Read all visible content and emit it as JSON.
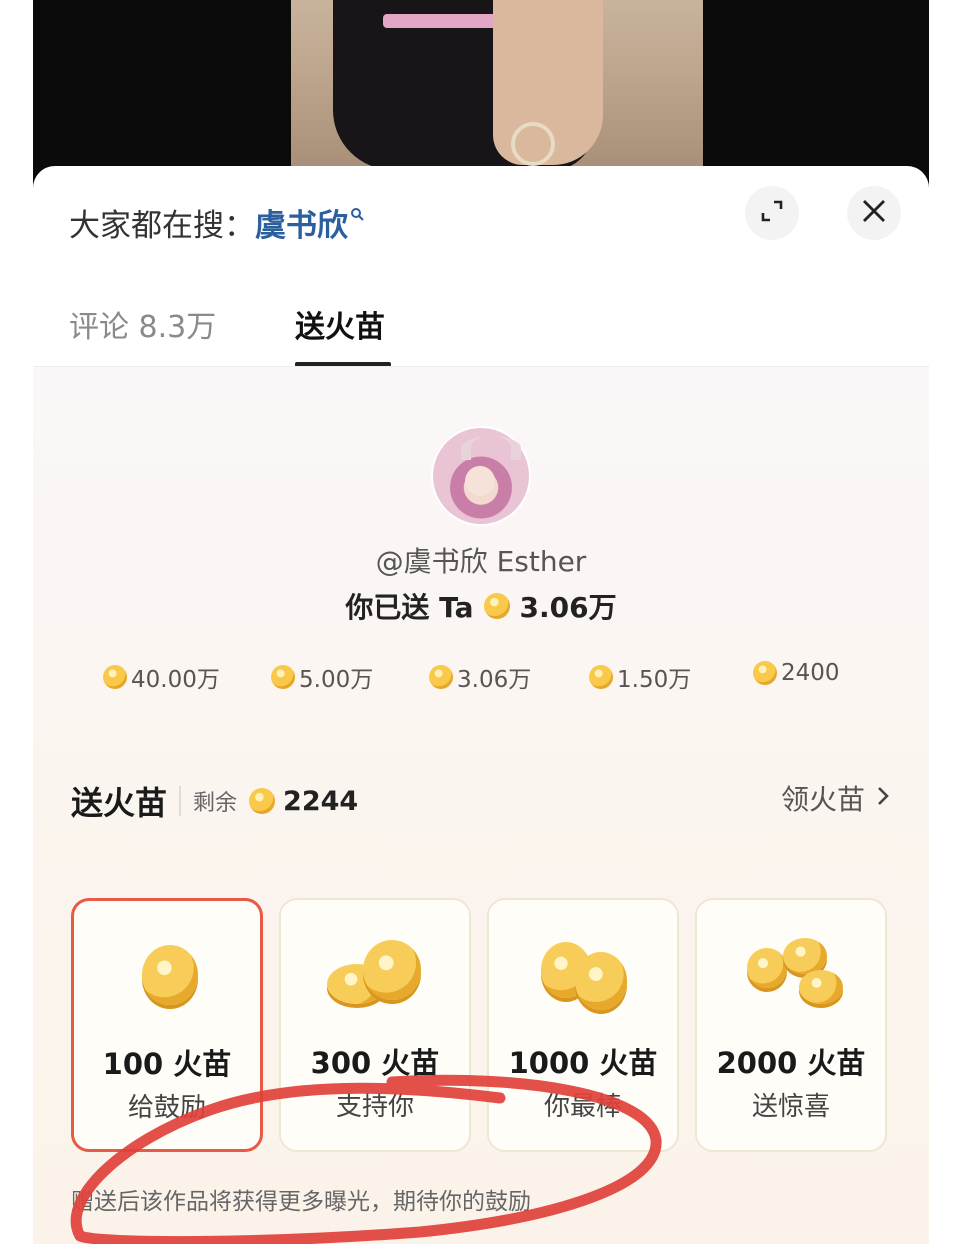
{
  "search_bar": {
    "prefix": "大家都在搜：",
    "term": "虞书欣"
  },
  "tabs": [
    {
      "label": "评论 8.3万"
    },
    {
      "label": "送火苗"
    }
  ],
  "creator": {
    "handle": "@虞书欣 Esther"
  },
  "sent": {
    "label": "你已送 Ta",
    "amount": "3.06万"
  },
  "tiers": [
    "40.00万",
    "5.00万",
    "3.06万",
    "1.50万",
    "2400"
  ],
  "gift_section": {
    "title": "送火苗",
    "remaining_label": "剩余",
    "remaining_value": "2244",
    "claim_label": "领火苗"
  },
  "gift_options": [
    {
      "title": "100 火苗",
      "subtitle": "给鼓励",
      "selected": true
    },
    {
      "title": "300 火苗",
      "subtitle": "支持你",
      "selected": false
    },
    {
      "title": "1000 火苗",
      "subtitle": "你最棒",
      "selected": false
    },
    {
      "title": "2000 火苗",
      "subtitle": "送惊喜",
      "selected": false
    }
  ],
  "footnote": "赠送后该作品将获得更多曝光，期待你的鼓励",
  "colors": {
    "accent_red": "#e85a45",
    "link_blue": "#2c5f9e",
    "coin_gold": "#f8c94a"
  }
}
